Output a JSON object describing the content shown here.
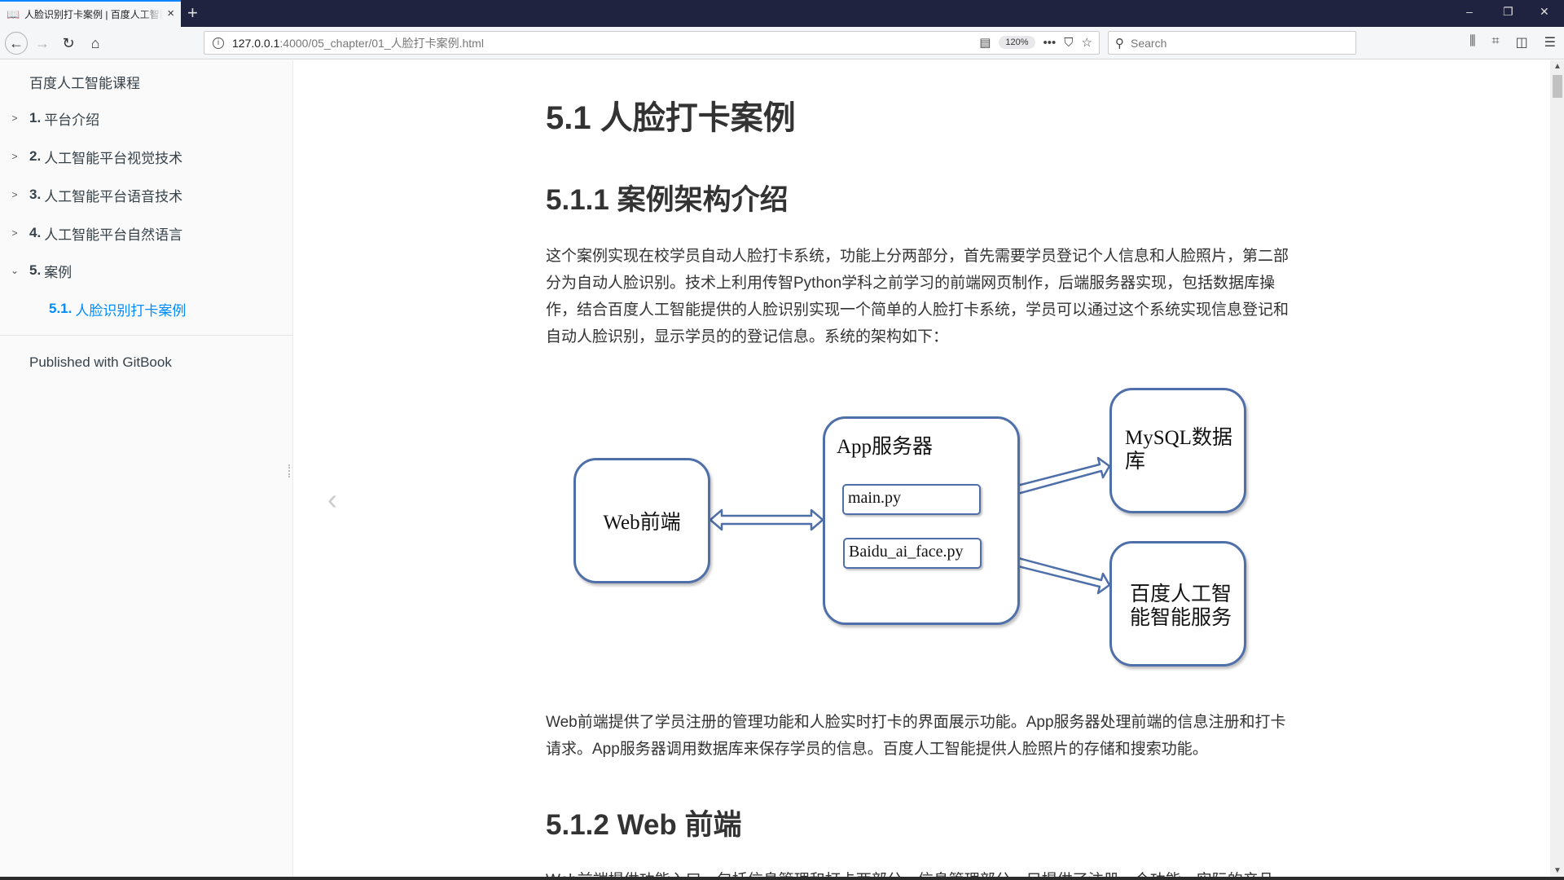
{
  "browser": {
    "tab_title": "人脸识别打卡案例 | 百度人工智能课程",
    "tab_icon": "book-icon",
    "new_tab_label": "+",
    "url_host": "127.0.0.1",
    "url_path": ":4000/05_chapter/01_人脸打卡案例.html",
    "zoom_level": "120%",
    "search_placeholder": "Search",
    "window_controls": {
      "minimize": "–",
      "restore": "❐",
      "close": "✕"
    }
  },
  "sidebar": {
    "title": "百度人工智能课程",
    "items": [
      {
        "num": "1.",
        "label": "平台介绍",
        "expanded": false
      },
      {
        "num": "2.",
        "label": "人工智能平台视觉技术",
        "expanded": false
      },
      {
        "num": "3.",
        "label": "人工智能平台语音技术",
        "expanded": false
      },
      {
        "num": "4.",
        "label": "人工智能平台自然语言",
        "expanded": false
      },
      {
        "num": "5.",
        "label": "案例",
        "expanded": true
      }
    ],
    "active_item": {
      "num": "5.1.",
      "label": "人脸识别打卡案例"
    },
    "published": "Published with GitBook"
  },
  "content": {
    "h1": "5.1 人脸打卡案例",
    "h2_1": "5.1.1 案例架构介绍",
    "para1": "这个案例实现在校学员自动人脸打卡系统，功能上分两部分，首先需要学员登记个人信息和人脸照片，第二部分为自动人脸识别。技术上利用传智Python学科之前学习的前端网页制作，后端服务器实现，包括数据库操作，结合百度人工智能提供的人脸识别实现一个简单的人脸打卡系统，学员可以通过这个系统实现信息登记和自动人脸识别，显示学员的的登记信息。系统的架构如下：",
    "diagram": {
      "web": "Web前端",
      "app": "App服务器",
      "main": "main.py",
      "baidu_py": "Baidu_ai_face.py",
      "mysql": "MySQL数据库",
      "baidu_service": "百度人工智能智能服务"
    },
    "para2": "Web前端提供了学员注册的管理功能和人脸实时打卡的界面展示功能。App服务器处理前端的信息注册和打卡请求。App服务器调用数据库来保存学员的信息。百度人工智能提供人脸照片的存储和搜索功能。",
    "h2_2": "5.1.2 Web 前端",
    "para3": "Web前端提供功能入口，包括信息管理和打卡两部分，信息管理部分，只提供了注册一个功能，实际的产品"
  }
}
